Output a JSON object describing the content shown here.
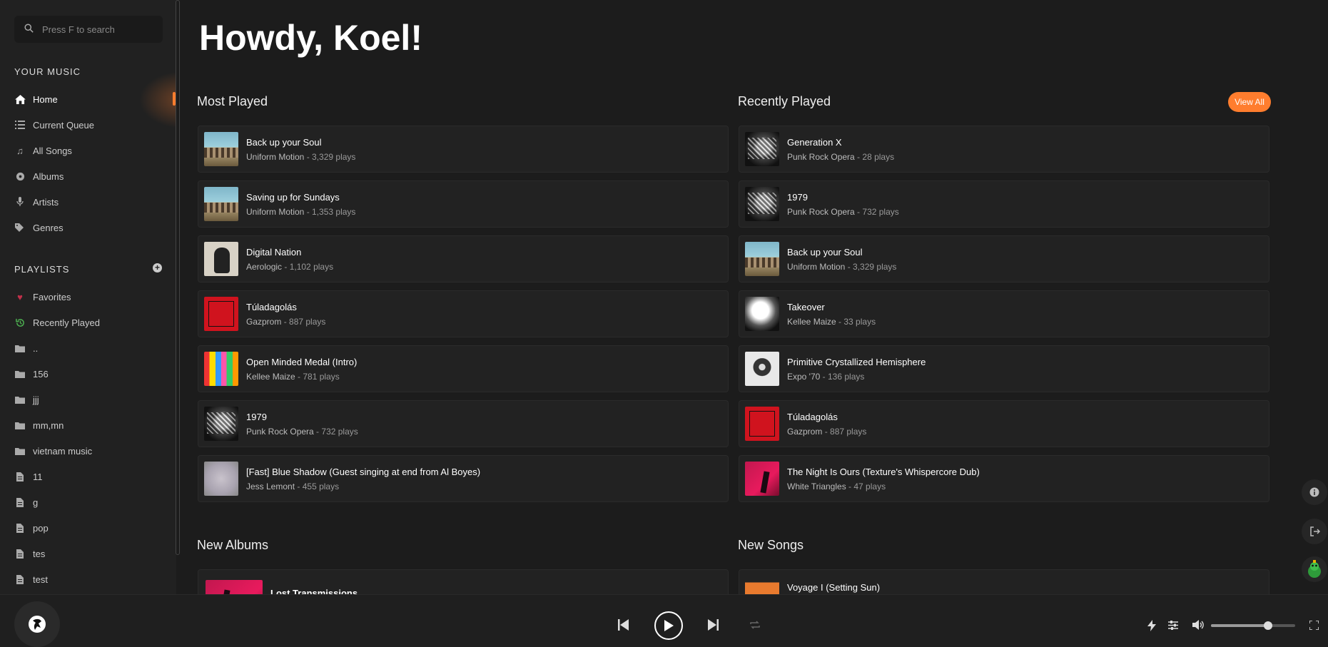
{
  "search": {
    "placeholder": "Press F to search"
  },
  "sidebar": {
    "your_music_title": "YOUR MUSIC",
    "music_items": [
      {
        "label": "Home",
        "icon": "home-icon"
      },
      {
        "label": "Current Queue",
        "icon": "queue-icon"
      },
      {
        "label": "All Songs",
        "icon": "music-note-icon"
      },
      {
        "label": "Albums",
        "icon": "disc-icon"
      },
      {
        "label": "Artists",
        "icon": "microphone-icon"
      },
      {
        "label": "Genres",
        "icon": "tags-icon"
      }
    ],
    "playlists_title": "PLAYLISTS",
    "playlist_items": [
      {
        "label": "Favorites",
        "icon": "heart-icon"
      },
      {
        "label": "Recently Played",
        "icon": "history-icon"
      },
      {
        "label": "..",
        "icon": "folder-icon"
      },
      {
        "label": "156",
        "icon": "folder-icon"
      },
      {
        "label": "jjj",
        "icon": "folder-icon"
      },
      {
        "label": "mm,mn",
        "icon": "folder-icon"
      },
      {
        "label": "vietnam music",
        "icon": "folder-icon"
      },
      {
        "label": "11",
        "icon": "file-icon"
      },
      {
        "label": "g",
        "icon": "file-icon"
      },
      {
        "label": "pop",
        "icon": "file-icon"
      },
      {
        "label": "tes",
        "icon": "file-icon"
      },
      {
        "label": "test",
        "icon": "file-icon"
      }
    ]
  },
  "main": {
    "greeting": "Howdy, Koel!",
    "most_played_title": "Most Played",
    "recently_played_title": "Recently Played",
    "view_all": "View All",
    "new_albums_title": "New Albums",
    "new_songs_title": "New Songs",
    "most_played": [
      {
        "title": "Back up your Soul",
        "artist": "Uniform Motion",
        "plays": "3,329 plays"
      },
      {
        "title": "Saving up for Sundays",
        "artist": "Uniform Motion",
        "plays": "1,353 plays"
      },
      {
        "title": "Digital Nation",
        "artist": "Aerologic",
        "plays": "1,102 plays"
      },
      {
        "title": "Túladagolás",
        "artist": "Gazprom",
        "plays": "887 plays"
      },
      {
        "title": "Open Minded Medal (Intro)",
        "artist": "Kellee Maize",
        "plays": "781 plays"
      },
      {
        "title": "1979",
        "artist": "Punk Rock Opera",
        "plays": "732 plays"
      },
      {
        "title": "[Fast] Blue Shadow (Guest singing at end from Al Boyes)",
        "artist": "Jess Lemont",
        "plays": "455 plays"
      }
    ],
    "recently_played": [
      {
        "title": "Generation X",
        "artist": "Punk Rock Opera",
        "plays": "28 plays"
      },
      {
        "title": "1979",
        "artist": "Punk Rock Opera",
        "plays": "732 plays"
      },
      {
        "title": "Back up your Soul",
        "artist": "Uniform Motion",
        "plays": "3,329 plays"
      },
      {
        "title": "Takeover",
        "artist": "Kellee Maize",
        "plays": "33 plays"
      },
      {
        "title": "Primitive Crystallized Hemisphere",
        "artist": "Expo '70",
        "plays": "136 plays"
      },
      {
        "title": "Túladagolás",
        "artist": "Gazprom",
        "plays": "887 plays"
      },
      {
        "title": "The Night Is Ours (Texture's Whispercore Dub)",
        "artist": "White Triangles",
        "plays": "47 plays"
      }
    ],
    "new_albums": [
      {
        "title": "Lost Transmissions"
      }
    ],
    "new_songs": [
      {
        "title": "Voyage I (Setting Sun)"
      }
    ],
    "separator": " - "
  },
  "footer": {
    "volume": 0.68,
    "icons": [
      "previous-icon",
      "play-icon",
      "next-icon",
      "repeat-icon",
      "lightning-icon",
      "equalizer-icon",
      "volume-icon",
      "fullscreen-icon"
    ]
  },
  "colors": {
    "accent": "#ff7d2e",
    "background": "#1c1c1c",
    "sidebar": "#212121",
    "card": "#222222"
  }
}
